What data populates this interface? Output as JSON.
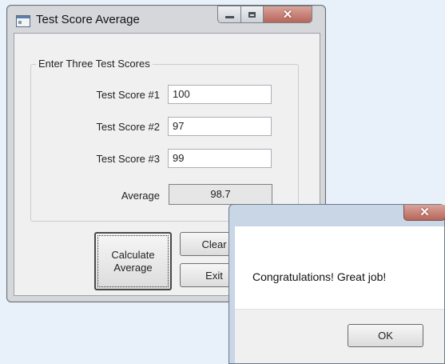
{
  "main_window": {
    "title": "Test Score Average",
    "group": {
      "label": "Enter Three Test Scores",
      "score1_label": "Test Score #1",
      "score1_value": "100",
      "score2_label": "Test Score #2",
      "score2_value": "97",
      "score3_label": "Test Score #3",
      "score3_value": "99",
      "average_label": "Average",
      "average_value": "98.7"
    },
    "buttons": {
      "calculate": "Calculate\nAverage",
      "clear": "Clear",
      "exit": "Exit"
    }
  },
  "message_box": {
    "text": "Congratulations! Great job!",
    "ok": "OK"
  }
}
